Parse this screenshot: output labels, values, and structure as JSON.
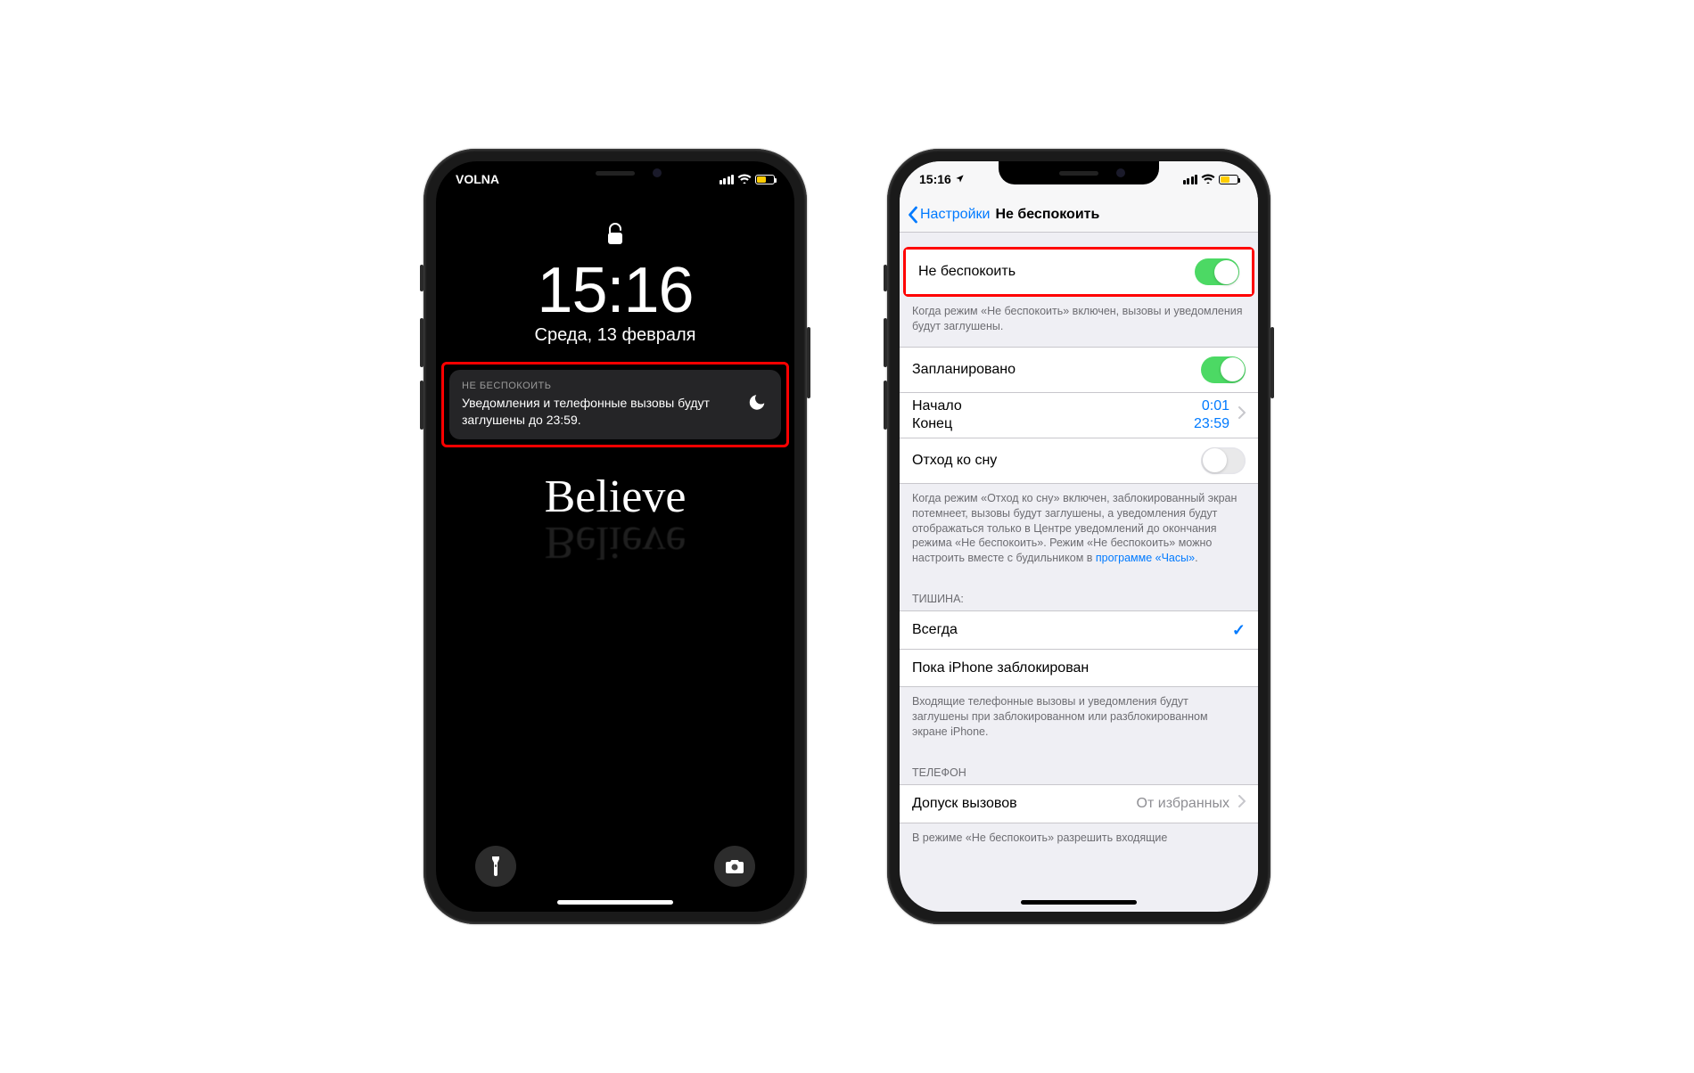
{
  "left": {
    "carrier": "VOLNA",
    "lock_time": "15:16",
    "lock_date": "Среда, 13 февраля",
    "notif_title": "НЕ БЕСПОКОИТЬ",
    "notif_body": "Уведомления и телефонные вызовы будут заглушены до 23:59.",
    "wallpaper_text": "Believe",
    "battery_color": "#ffcc00",
    "battery_pct": 50
  },
  "right": {
    "status_time": "15:16",
    "nav_back": "Настройки",
    "nav_title": "Не беспокоить",
    "row_dnd": "Не беспокоить",
    "dnd_footer": "Когда режим «Не беспокоить» включен, вызовы и уведомления будут заглушены.",
    "row_scheduled": "Запланировано",
    "row_start_label": "Начало",
    "row_start_value": "0:01",
    "row_end_label": "Конец",
    "row_end_value": "23:59",
    "row_bedtime": "Отход ко сну",
    "bedtime_footer_1": "Когда режим «Отход ко сну» включен, заблокированный экран потемнеет, вызовы будут заглушены, а уведомления будут отображаться только в Центре уведомлений до окончания режима «Не беспокоить». Режим «Не беспокоить» можно настроить вместе с будильником в ",
    "bedtime_footer_link": "программе «Часы»",
    "bedtime_footer_2": ".",
    "silence_header": "ТИШИНА:",
    "row_always": "Всегда",
    "row_while_locked": "Пока iPhone заблокирован",
    "silence_footer": "Входящие телефонные вызовы и уведомления будут заглушены при заблокированном или разблокированном экране iPhone.",
    "phone_header": "ТЕЛЕФОН",
    "row_allow_calls": "Допуск вызовов",
    "row_allow_calls_value": "От избранных",
    "allow_footer": "В режиме «Не беспокоить» разрешить входящие",
    "battery_color": "#ffcc00",
    "battery_pct": 50
  }
}
